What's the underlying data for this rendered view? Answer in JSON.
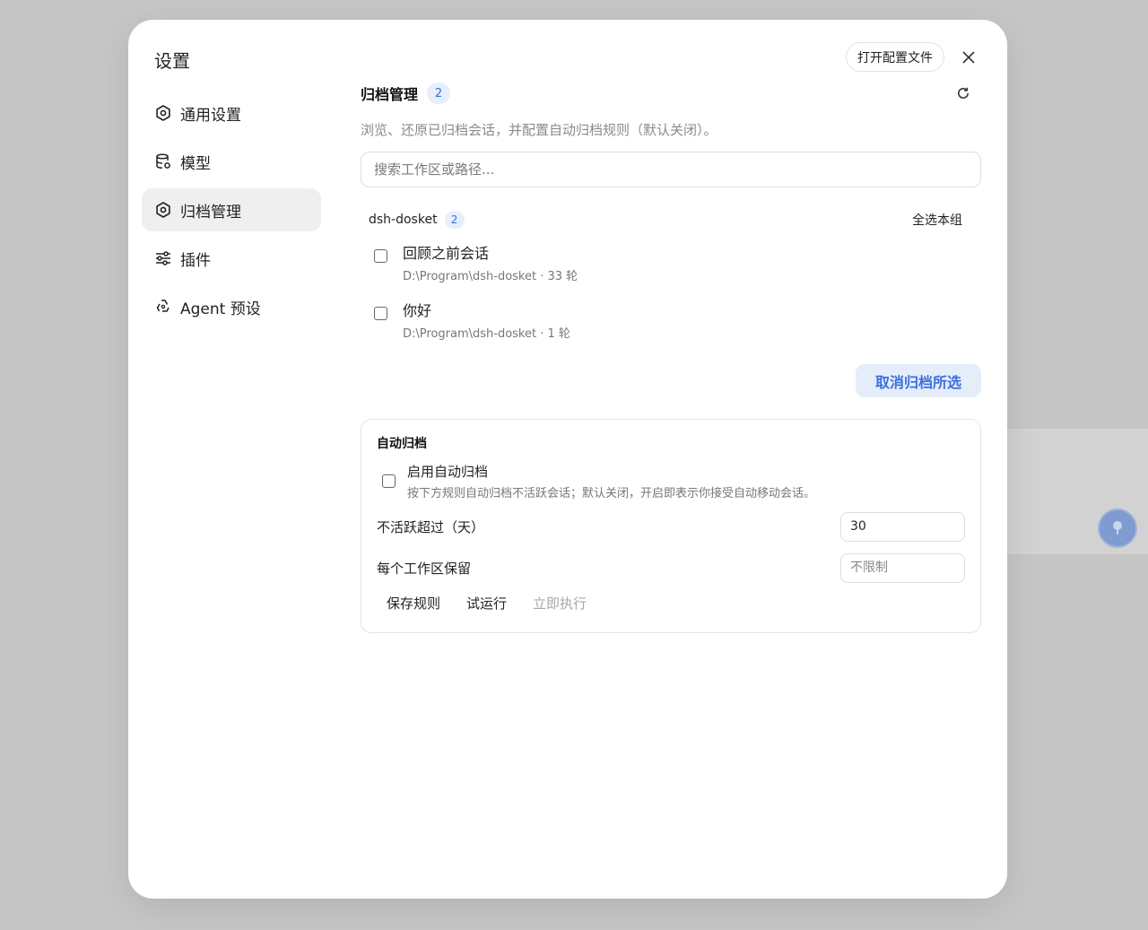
{
  "modal": {
    "title": "设置"
  },
  "nav": {
    "items": [
      {
        "label": "通用设置",
        "icon": "gear-icon",
        "active": false
      },
      {
        "label": "模型",
        "icon": "database-icon",
        "active": false
      },
      {
        "label": "归档管理",
        "icon": "gear-icon",
        "active": true
      },
      {
        "label": "插件",
        "icon": "sliders-icon",
        "active": false
      },
      {
        "label": "Agent 预设",
        "icon": "recycle-icon",
        "active": false
      }
    ]
  },
  "header": {
    "open_config_label": "打开配置文件"
  },
  "archive": {
    "title": "归档管理",
    "count": "2",
    "description": "浏览、还原已归档会话，并配置自动归档规则（默认关闭）。",
    "search_placeholder": "搜索工作区或路径...",
    "group": {
      "name": "dsh-dosket",
      "count": "2",
      "select_all_label": "全选本组",
      "sessions": [
        {
          "title": "回顾之前会话",
          "meta": "D:\\Program\\dsh-dosket · 33 轮"
        },
        {
          "title": "你好",
          "meta": "D:\\Program\\dsh-dosket · 1 轮"
        }
      ]
    },
    "unarchive_label": "取消归档所选"
  },
  "auto_archive": {
    "title": "自动归档",
    "enable_label": "启用自动归档",
    "enable_help": "按下方规则自动归档不活跃会话；默认关闭，开启即表示你接受自动移动会话。",
    "inactive_label": "不活跃超过（天）",
    "inactive_value": "30",
    "keep_label": "每个工作区保留",
    "keep_placeholder": "不限制",
    "save_label": "保存规则",
    "dry_run_label": "试运行",
    "run_now_label": "立即执行"
  }
}
